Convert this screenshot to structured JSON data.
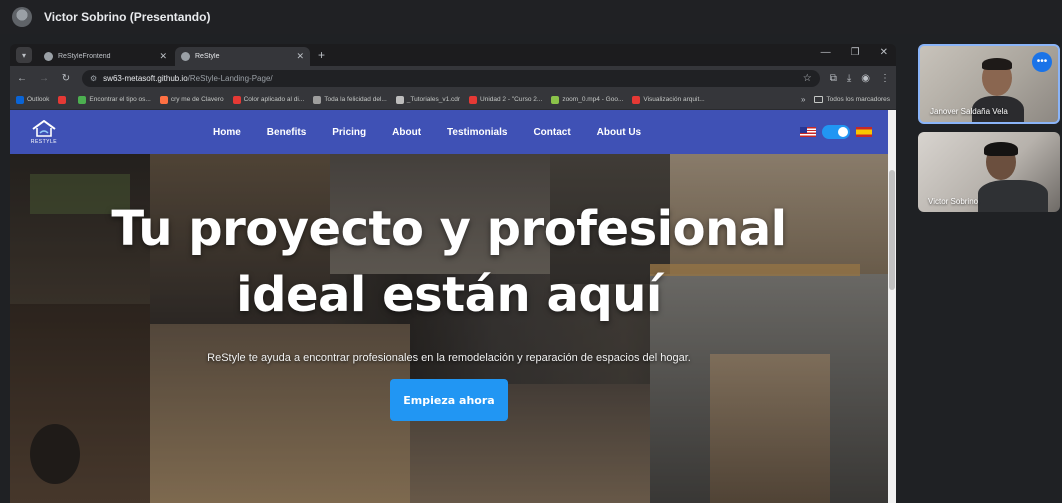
{
  "meeting": {
    "presenter_label": "Victor Sobrino (Presentando)",
    "participants": [
      {
        "name": "Janover Saldaña Vela"
      },
      {
        "name": "Victor Sobrino"
      }
    ],
    "tile_menu_glyph": "•••"
  },
  "browser": {
    "tabs": [
      {
        "title": "ReStyleFrontend",
        "active": false
      },
      {
        "title": "ReStyle",
        "active": true
      }
    ],
    "url_host": "sw63-metasoft.github.io",
    "url_path": "/ReStyle-Landing-Page/",
    "bookmarks": [
      {
        "label": "Outlook",
        "color": "#0a64d6"
      },
      {
        "label": "",
        "color": "#e53935"
      },
      {
        "label": "Encontrar el tipo os...",
        "color": "#4caf50"
      },
      {
        "label": "cry me de Clavero",
        "color": "#ff7043"
      },
      {
        "label": "Color aplicado al di...",
        "color": "#e53935"
      },
      {
        "label": "Toda la felicidad del...",
        "color": "#9e9e9e"
      },
      {
        "label": "_Tutoriales_v1.cdr",
        "color": "#bdbdbd"
      },
      {
        "label": "Unidad 2 - \"Curso 2...",
        "color": "#e53935"
      },
      {
        "label": "zoom_0.mp4 - Goo...",
        "color": "#8bc34a"
      },
      {
        "label": "Visualización arquit...",
        "color": "#e53935"
      }
    ],
    "bookmarks_folder": "Todos los marcadores"
  },
  "site": {
    "logo_text": "RESTYLE",
    "nav": [
      "Home",
      "Benefits",
      "Pricing",
      "About",
      "Testimonials",
      "Contact",
      "About Us"
    ],
    "hero_title_line1": "Tu proyecto y profesional",
    "hero_title_line2": "ideal están aquí",
    "hero_subtitle": "ReStyle te ayuda a encontrar profesionales en la remodelación y reparación de espacios del hogar.",
    "cta_label": "Empieza ahora",
    "colors": {
      "nav_bg": "#3f51b5",
      "cta_bg": "#2196f3"
    }
  }
}
